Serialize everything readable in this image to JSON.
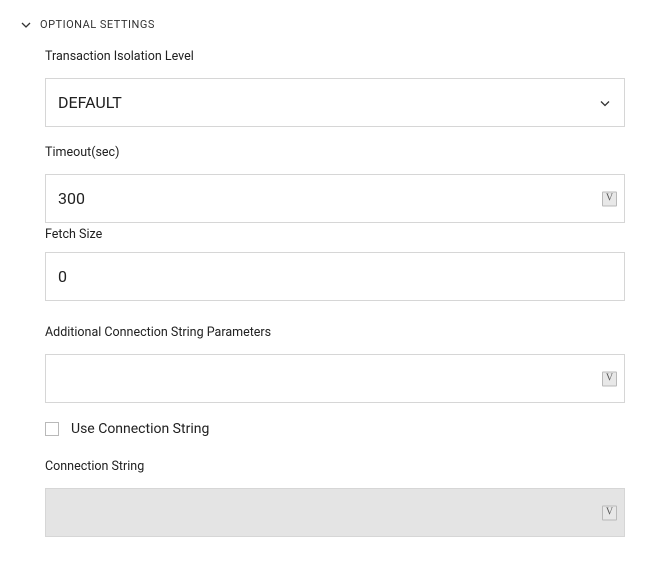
{
  "section": {
    "title": "OPTIONAL SETTINGS"
  },
  "isolation": {
    "label": "Transaction Isolation Level",
    "value": "DEFAULT"
  },
  "timeout": {
    "label": "Timeout(sec)",
    "value": "300"
  },
  "fetchSize": {
    "label": "Fetch Size",
    "value": "0"
  },
  "additionalParams": {
    "label": "Additional Connection String Parameters",
    "value": ""
  },
  "useConnString": {
    "label": "Use Connection String",
    "checked": false
  },
  "connString": {
    "label": "Connection String",
    "value": ""
  },
  "badge": {
    "char": "V"
  }
}
